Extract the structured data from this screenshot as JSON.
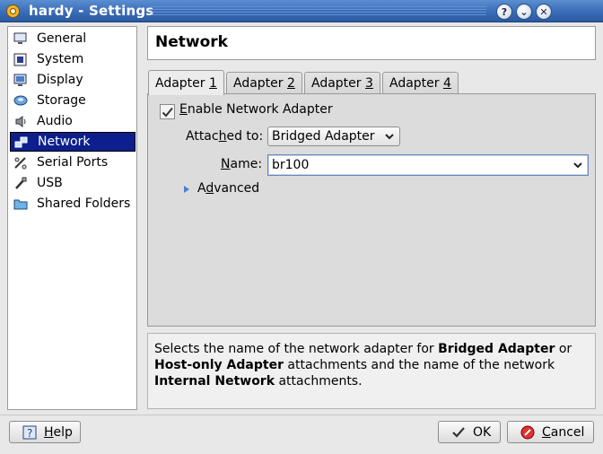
{
  "window": {
    "title": "hardy - Settings",
    "buttons": {
      "help": "?",
      "minimize": "⌄",
      "close": "✕"
    }
  },
  "sidebar": {
    "items": [
      {
        "label": "General",
        "icon": "monitor-icon"
      },
      {
        "label": "System",
        "icon": "chip-icon"
      },
      {
        "label": "Display",
        "icon": "display-icon"
      },
      {
        "label": "Storage",
        "icon": "disk-icon"
      },
      {
        "label": "Audio",
        "icon": "speaker-icon"
      },
      {
        "label": "Network",
        "icon": "network-icon",
        "selected": true
      },
      {
        "label": "Serial Ports",
        "icon": "serial-port-icon"
      },
      {
        "label": "USB",
        "icon": "usb-icon"
      },
      {
        "label": "Shared Folders",
        "icon": "folder-icon"
      }
    ]
  },
  "page": {
    "title": "Network"
  },
  "tabs": [
    {
      "prefix": "Adapter ",
      "mnemonic": "1",
      "active": true
    },
    {
      "prefix": "Adapter ",
      "mnemonic": "2"
    },
    {
      "prefix": "Adapter ",
      "mnemonic": "3"
    },
    {
      "prefix": "Adapter ",
      "mnemonic": "4"
    }
  ],
  "adapter": {
    "enable_pre": "",
    "enable_mn": "E",
    "enable_post": "nable Network Adapter",
    "enabled": true,
    "attached_pre": "Attac",
    "attached_mn": "h",
    "attached_post": "ed to:",
    "attached_value": "Bridged Adapter",
    "name_pre": "",
    "name_mn": "N",
    "name_post": "ame:",
    "name_value": "br100",
    "advanced_pre": "A",
    "advanced_mn": "d",
    "advanced_post": "vanced"
  },
  "description": {
    "p1": "Selects the name of the network adapter for ",
    "b1": "Bridged Adapter",
    "p2": " or ",
    "b2": "Host-only Adapter",
    "p3": " attachments and the name of the network ",
    "b3": "Internal Network",
    "p4": " attachments."
  },
  "buttons": {
    "help_mn": "H",
    "help_rest": "elp",
    "ok": "OK",
    "cancel_mn": "C",
    "cancel_rest": "ancel"
  },
  "colors": {
    "titlebar": "#3a6cb8",
    "selection": "#0c1f8c",
    "panel": "#dcdcdc"
  }
}
